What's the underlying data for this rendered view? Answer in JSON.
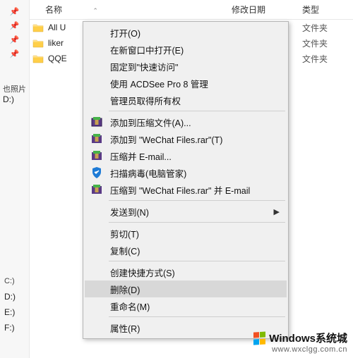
{
  "header": {
    "name": "名称",
    "sort_indicator": "⌃",
    "date": "修改日期",
    "type": "类型"
  },
  "left": {
    "quick_access_label": "也照片",
    "quick_drive": "D:)",
    "drives": [
      "C:)",
      "D:)",
      "E:)",
      "F:)"
    ]
  },
  "rows": [
    {
      "name": "All U",
      "date": "",
      "type": "文件夹"
    },
    {
      "name": "liker",
      "date": "",
      "type": "文件夹"
    },
    {
      "name": "QQE",
      "date": "",
      "type": "文件夹"
    }
  ],
  "menu": {
    "open": "打开(O)",
    "open_new_window": "在新窗口中打开(E)",
    "pin_quick": "固定到\"快速访问\"",
    "acdsee": "使用 ACDSee Pro 8 管理",
    "admin_own": "管理员取得所有权",
    "add_archive": "添加到压缩文件(A)...",
    "add_to_wechat": "添加到 \"WeChat Files.rar\"(T)",
    "compress_email": "压缩并 E-mail...",
    "scan_virus": "扫描病毒(电脑管家)",
    "compress_wechat_email": "压缩到 \"WeChat Files.rar\" 并 E-mail",
    "send_to": "发送到(N)",
    "cut": "剪切(T)",
    "copy": "复制(C)",
    "create_shortcut": "创建快捷方式(S)",
    "delete": "删除(D)",
    "rename": "重命名(M)",
    "properties": "属性(R)"
  },
  "watermark": {
    "line1": "Windows系统城",
    "line2": "www.wxclgg.com.cn"
  }
}
